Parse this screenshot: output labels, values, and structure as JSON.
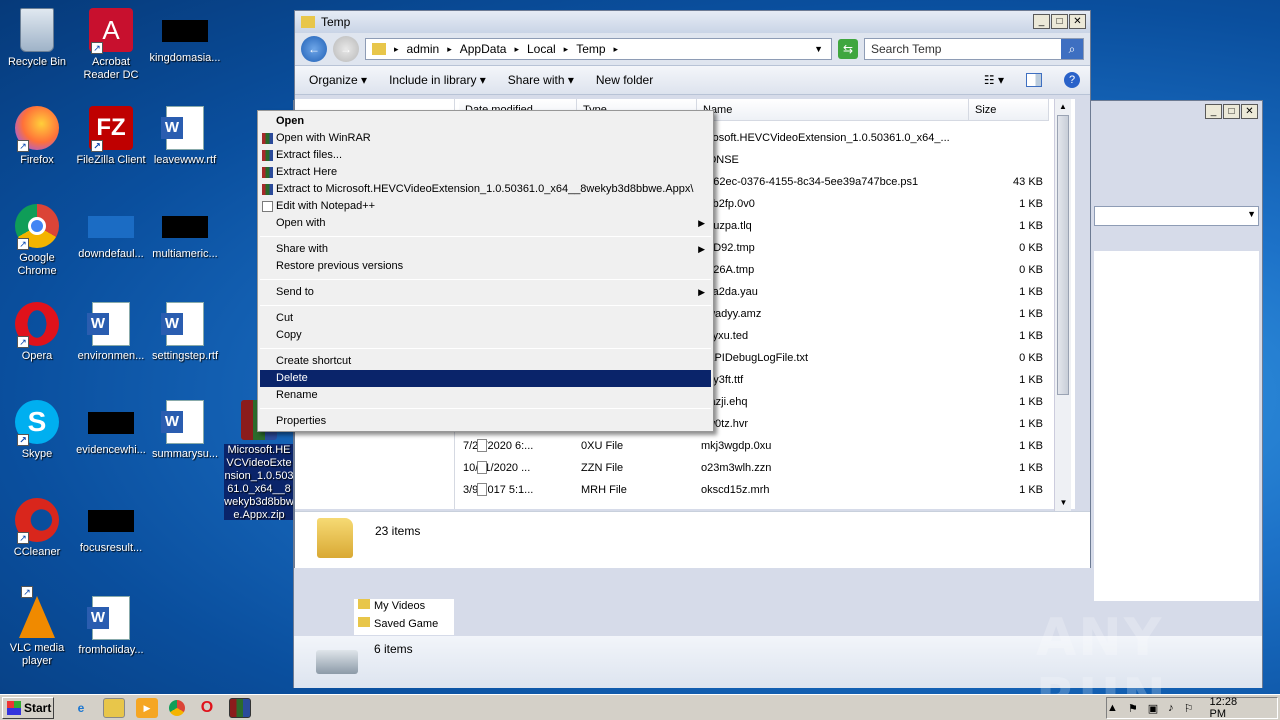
{
  "desktop": {
    "icons": [
      {
        "label": "Recycle Bin"
      },
      {
        "label": "Acrobat Reader DC"
      },
      {
        "label": "kingdomasia..."
      },
      {
        "label": "Firefox"
      },
      {
        "label": "FileZilla Client"
      },
      {
        "label": "leavewww.rtf"
      },
      {
        "label": "Google Chrome"
      },
      {
        "label": "downdefaul..."
      },
      {
        "label": "multiameric..."
      },
      {
        "label": "Opera"
      },
      {
        "label": "environmen..."
      },
      {
        "label": "settingstep.rtf"
      },
      {
        "label": "Skype"
      },
      {
        "label": "evidencewhi..."
      },
      {
        "label": "summarysu..."
      },
      {
        "label": "CCleaner"
      },
      {
        "label": "focusresult..."
      },
      {
        "label": "VLC media player"
      },
      {
        "label": "fromholiday..."
      }
    ],
    "selected_file": "Microsoft.HEVCVideoExtension_1.0.50361.0_x64__8wekyb3d8bbwe.Appx.zip"
  },
  "explorer_main": {
    "title": "Temp",
    "breadcrumb": [
      "admin",
      "AppData",
      "Local",
      "Temp"
    ],
    "search_placeholder": "Search Temp",
    "toolbar": {
      "organize": "Organize",
      "include": "Include in library",
      "share": "Share with",
      "newfolder": "New folder"
    },
    "columns": {
      "date": "Date modified",
      "type": "Type",
      "name": "Name",
      "size": "Size"
    },
    "files": [
      {
        "date": "",
        "type": "",
        "name": "icrosoft.HEVCVideoExtension_1.0.50361.0_x64_...",
        "size": ""
      },
      {
        "date": "",
        "type": "",
        "name": "PDNSE",
        "size": ""
      },
      {
        "date": "",
        "type": "",
        "name": "3262ec-0376-4155-8c34-5ee39a747bce.ps1",
        "size": "43 KB"
      },
      {
        "date": "",
        "type": "",
        "name": "c4b2fp.0v0",
        "size": "1 KB"
      },
      {
        "date": "",
        "type": "",
        "name": "0puzpa.tlq",
        "size": "1 KB"
      },
      {
        "date": "",
        "type": "",
        "name": "II5D92.tmp",
        "size": "0 KB"
      },
      {
        "date": "",
        "type": "",
        "name": "II326A.tmp",
        "size": "0 KB"
      },
      {
        "date": "",
        "type": "",
        "name": "sqa2da.yau",
        "size": "1 KB"
      },
      {
        "date": "",
        "type": "",
        "name": "2wadyy.amz",
        "size": "1 KB"
      },
      {
        "date": "",
        "type": "",
        "name": "4syxu.ted",
        "size": "1 KB"
      },
      {
        "date": "",
        "type": "",
        "name": "6APIDebugLogFile.txt",
        "size": "0 KB"
      },
      {
        "date": "",
        "type": "",
        "name": "qoy3ft.ttf",
        "size": "1 KB"
      },
      {
        "date": "",
        "type": "",
        "name": "vtazji.ehq",
        "size": "1 KB"
      },
      {
        "date": "",
        "type": "",
        "name": "nw0tz.hvr",
        "size": "1 KB"
      },
      {
        "date": "7/27/2020 6:...",
        "type": "0XU File",
        "name": "mkj3wgdp.0xu",
        "size": "1 KB"
      },
      {
        "date": "10/21/2020 ...",
        "type": "ZZN File",
        "name": "o23m3wlh.zzn",
        "size": "1 KB"
      },
      {
        "date": "3/9/2017 5:1...",
        "type": "MRH File",
        "name": "okscd15z.mrh",
        "size": "1 KB"
      }
    ],
    "status": "23 items"
  },
  "explorer_back": {
    "status": "6 items",
    "nav_items": [
      "My Videos",
      "Saved Game"
    ]
  },
  "context_menu": [
    {
      "label": "Open",
      "bold": true
    },
    {
      "label": "Open with WinRAR",
      "icon": "winrar"
    },
    {
      "label": "Extract files...",
      "icon": "winrar"
    },
    {
      "label": "Extract Here",
      "icon": "winrar"
    },
    {
      "label": "Extract to Microsoft.HEVCVideoExtension_1.0.50361.0_x64__8wekyb3d8bbwe.Appx\\",
      "icon": "winrar"
    },
    {
      "label": "Edit with Notepad++",
      "icon": "notepad"
    },
    {
      "label": "Open with",
      "submenu": true
    },
    {
      "sep": true
    },
    {
      "label": "Share with",
      "submenu": true
    },
    {
      "label": "Restore previous versions"
    },
    {
      "sep": true
    },
    {
      "label": "Send to",
      "submenu": true
    },
    {
      "sep": true
    },
    {
      "label": "Cut"
    },
    {
      "label": "Copy"
    },
    {
      "sep": true
    },
    {
      "label": "Create shortcut"
    },
    {
      "label": "Delete",
      "selected": true
    },
    {
      "label": "Rename"
    },
    {
      "sep": true
    },
    {
      "label": "Properties"
    }
  ],
  "taskbar": {
    "start": "Start",
    "time": "12:28 PM"
  },
  "watermark": "ANY RUN"
}
